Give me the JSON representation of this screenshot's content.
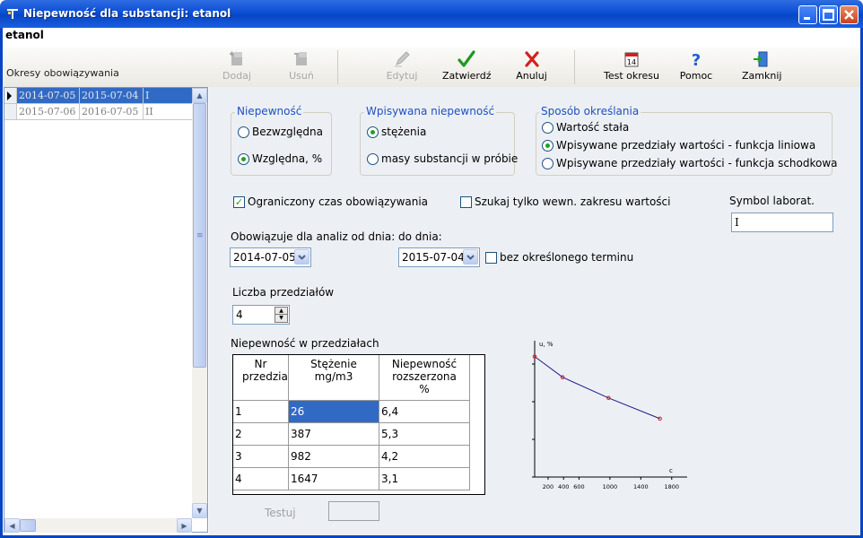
{
  "window": {
    "title": "Niepewność dla substancji: etanol"
  },
  "substance": "etanol",
  "toolbar": {
    "add": "Dodaj",
    "delete": "Usuń",
    "edit": "Edytuj",
    "confirm": "Zatwierdź",
    "cancel": "Anuluj",
    "test_period": "Test okresu",
    "help": "Pomoc",
    "close": "Zamknij"
  },
  "periods": {
    "label": "Okresy obowiązywania",
    "rows": [
      {
        "from": "2014-07-05",
        "to": "2015-07-04",
        "symbol": "I"
      },
      {
        "from": "2015-07-06",
        "to": "2016-07-05",
        "symbol": "II"
      }
    ]
  },
  "uncertainty": {
    "label": "Niepewność",
    "absolute": "Bezwzględna",
    "relative": "Względna, %"
  },
  "entered": {
    "label": "Wpisywana niepewność",
    "concentration": "stężenia",
    "mass": "masy substancji w próbie"
  },
  "method": {
    "label": "Sposób określania",
    "constant": "Wartość stała",
    "linear": "Wpisywane przedziały wartości - funkcja  liniowa",
    "step": "Wpisywane przedziały wartości - funkcja  schodkowa"
  },
  "limited_time": "Ograniczony czas obowiązywania",
  "internal_range": "Szukaj tylko wewn. zakresu wartości",
  "lab_symbol": {
    "label": "Symbol laborat.",
    "value": "I"
  },
  "valid_from": {
    "label": "Obowiązuje  dla analiz od dnia:",
    "value": "2014-07-05"
  },
  "valid_to": {
    "label": "do dnia:",
    "value": "2015-07-04"
  },
  "no_term": "bez określonego terminu",
  "intervals_count": {
    "label": "Liczba przedziałów",
    "value": "4"
  },
  "intervals_table": {
    "label": "Niepewność w przedziałach",
    "headers": [
      "Nr przedziału",
      "Stężenie mg/m3",
      "Niepewność rozszerzona %"
    ],
    "rows": [
      [
        "1",
        "26",
        "6,4"
      ],
      [
        "2",
        "387",
        "5,3"
      ],
      [
        "3",
        "982",
        "4,2"
      ],
      [
        "4",
        "1647",
        "3,1"
      ]
    ]
  },
  "test_button": "Testuj",
  "chart_data": {
    "type": "line",
    "ylabel": "u, %",
    "xlabel": "c",
    "x": [
      26,
      387,
      982,
      1647
    ],
    "y": [
      6.4,
      5.3,
      4.2,
      3.1
    ],
    "xlim": [
      26,
      2000
    ],
    "ylim": [
      0,
      7
    ],
    "x_ticks": [
      "200",
      "400",
      "600",
      "1000",
      "1400",
      "1800"
    ],
    "y_ticks": [
      "0",
      "2",
      "4",
      "6"
    ],
    "line_color": "#1a1a8c",
    "marker_color": "#d42020"
  }
}
